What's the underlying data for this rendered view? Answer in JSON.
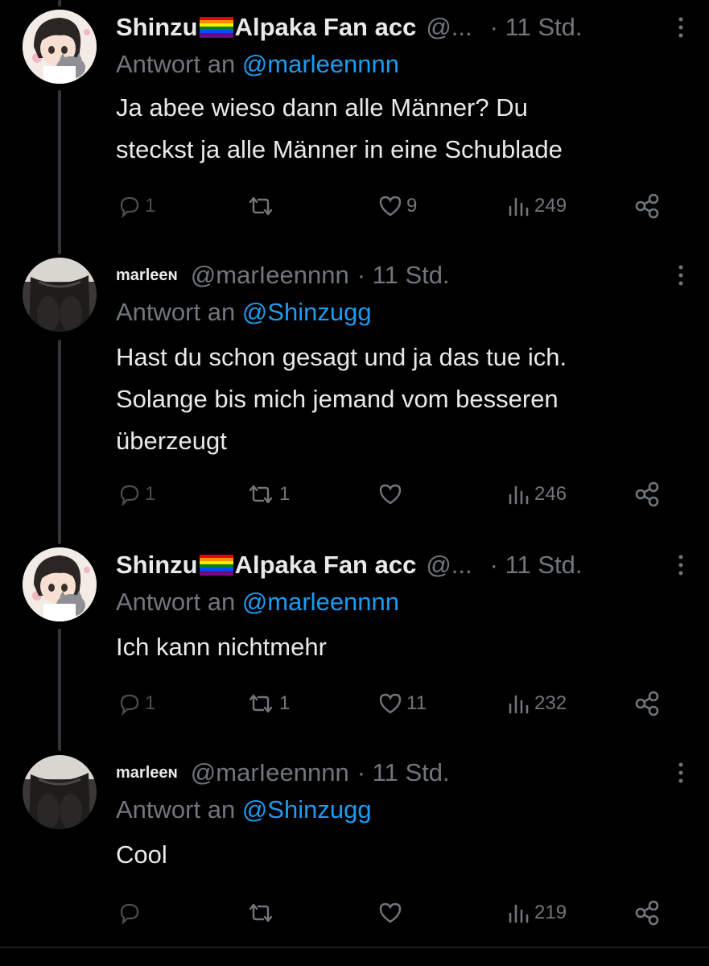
{
  "colors": {
    "background": "#000000",
    "text": "#e7e9ea",
    "muted": "#71767b",
    "link": "#1d9bf0",
    "thread_line": "#333639"
  },
  "tweets": [
    {
      "display_name": "Shinzu",
      "display_name_suffix": "Alpaka Fan acc",
      "handle": "@...",
      "time": "· 11 Std.",
      "reply_prefix": "Antwort an",
      "reply_handle": "@marleennnn",
      "text_lines": [
        "Ja abee wieso dann alle Männer? Du",
        "steckst ja alle Männer in eine Schublade"
      ],
      "replies": "1",
      "reposts": "",
      "likes": "9",
      "views": "249",
      "icons": [
        "reply-icon",
        "repost-icon",
        "like-icon",
        "views-icon",
        "share-icon"
      ]
    },
    {
      "display_name": "marleeɴ",
      "handle": "@marIeennnn",
      "time": "· 11 Std.",
      "reply_prefix": "Antwort an",
      "reply_handle": "@Shinzugg",
      "text_lines": [
        "Hast du schon gesagt und ja das tue ich.",
        "Solange bis mich jemand vom besseren",
        "überzeugt"
      ],
      "replies": "1",
      "reposts": "1",
      "likes": "",
      "views": "246",
      "icons": [
        "reply-icon",
        "repost-icon",
        "like-icon",
        "views-icon",
        "share-icon"
      ]
    },
    {
      "display_name": "Shinzu",
      "display_name_suffix": "Alpaka Fan acc",
      "handle": "@...",
      "time": "· 11 Std.",
      "reply_prefix": "Antwort an",
      "reply_handle": "@marleennnn",
      "text_lines": [
        "Ich kann nichtmehr"
      ],
      "replies": "1",
      "reposts": "1",
      "likes": "11",
      "views": "232",
      "icons": [
        "reply-icon",
        "repost-icon",
        "like-icon",
        "views-icon",
        "share-icon"
      ]
    },
    {
      "display_name": "marleeɴ",
      "handle": "@marIeennnn",
      "time": "· 11 Std.",
      "reply_prefix": "Antwort an",
      "reply_handle": "@Shinzugg",
      "text_lines": [
        "Cool"
      ],
      "replies": "",
      "reposts": "",
      "likes": "",
      "views": "219",
      "icons": [
        "reply-icon",
        "repost-icon",
        "like-icon",
        "views-icon",
        "share-icon"
      ]
    }
  ]
}
